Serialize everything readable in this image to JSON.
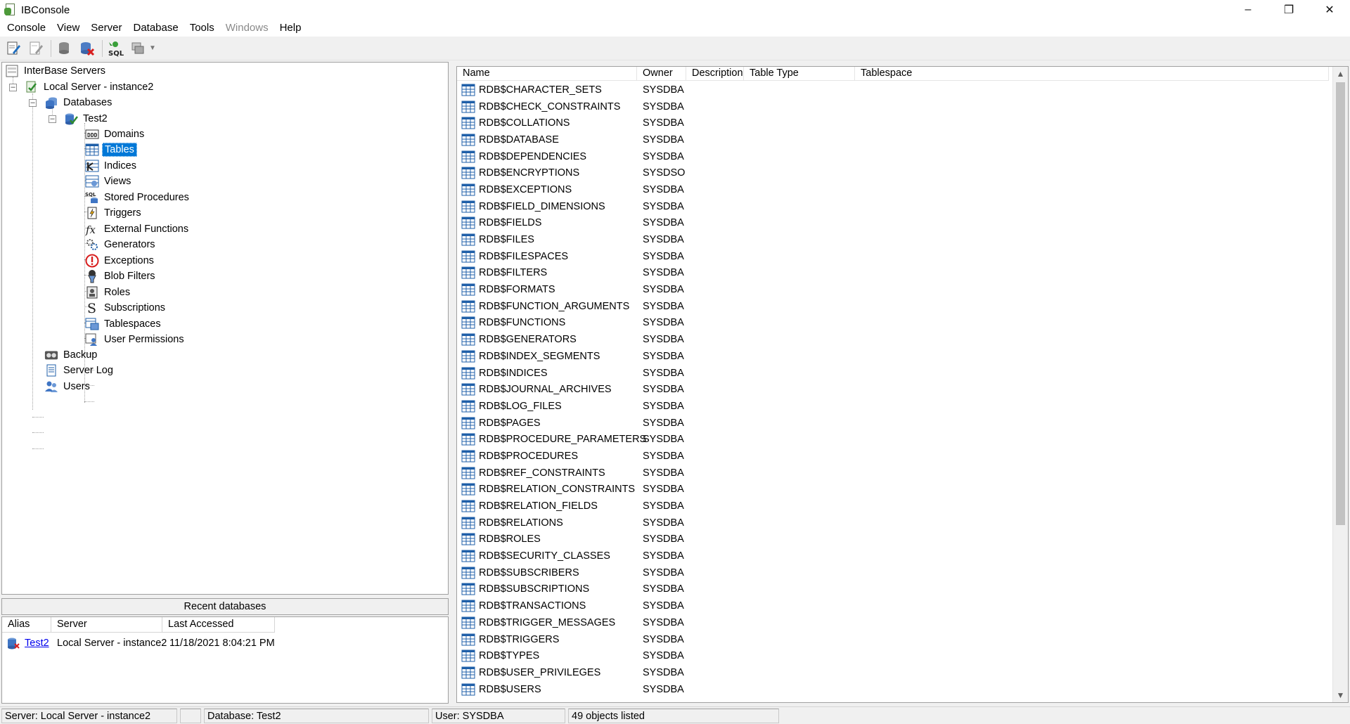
{
  "window": {
    "title": "IBConsole",
    "controls": [
      "–",
      "❐",
      "✕"
    ]
  },
  "menu": [
    {
      "label": "Console",
      "enabled": true
    },
    {
      "label": "View",
      "enabled": true
    },
    {
      "label": "Server",
      "enabled": true
    },
    {
      "label": "Database",
      "enabled": true
    },
    {
      "label": "Tools",
      "enabled": true
    },
    {
      "label": "Windows",
      "enabled": false
    },
    {
      "label": "Help",
      "enabled": true
    }
  ],
  "toolbar": {
    "buttons": [
      "register-server-icon",
      "unregister-server-icon",
      "connect-database-icon",
      "disconnect-database-icon",
      "interactive-sql-icon",
      "window-list-icon"
    ]
  },
  "tree": {
    "root": "InterBase Servers",
    "server": "Local Server - instance2",
    "databases": "Databases",
    "database": "Test2",
    "children": [
      "Domains",
      "Tables",
      "Indices",
      "Views",
      "Stored Procedures",
      "Triggers",
      "External Functions",
      "Generators",
      "Exceptions",
      "Blob Filters",
      "Roles",
      "Subscriptions",
      "Tablespaces",
      "User Permissions"
    ],
    "server_children": [
      "Backup",
      "Server Log",
      "Users"
    ],
    "selected": "Tables"
  },
  "recent": {
    "header": "Recent databases",
    "columns": [
      "Alias",
      "Server",
      "Last Accessed"
    ],
    "rows": [
      {
        "alias": "Test2",
        "server": "Local Server - instance2",
        "last_accessed": "11/18/2021 8:04:21 PM"
      }
    ]
  },
  "list": {
    "columns": [
      "Name",
      "Owner",
      "Description",
      "Table Type",
      "Tablespace"
    ],
    "rows": [
      {
        "name": "RDB$CHARACTER_SETS",
        "owner": "SYSDBA"
      },
      {
        "name": "RDB$CHECK_CONSTRAINTS",
        "owner": "SYSDBA"
      },
      {
        "name": "RDB$COLLATIONS",
        "owner": "SYSDBA"
      },
      {
        "name": "RDB$DATABASE",
        "owner": "SYSDBA"
      },
      {
        "name": "RDB$DEPENDENCIES",
        "owner": "SYSDBA"
      },
      {
        "name": "RDB$ENCRYPTIONS",
        "owner": "SYSDSO"
      },
      {
        "name": "RDB$EXCEPTIONS",
        "owner": "SYSDBA"
      },
      {
        "name": "RDB$FIELD_DIMENSIONS",
        "owner": "SYSDBA"
      },
      {
        "name": "RDB$FIELDS",
        "owner": "SYSDBA"
      },
      {
        "name": "RDB$FILES",
        "owner": "SYSDBA"
      },
      {
        "name": "RDB$FILESPACES",
        "owner": "SYSDBA"
      },
      {
        "name": "RDB$FILTERS",
        "owner": "SYSDBA"
      },
      {
        "name": "RDB$FORMATS",
        "owner": "SYSDBA"
      },
      {
        "name": "RDB$FUNCTION_ARGUMENTS",
        "owner": "SYSDBA"
      },
      {
        "name": "RDB$FUNCTIONS",
        "owner": "SYSDBA"
      },
      {
        "name": "RDB$GENERATORS",
        "owner": "SYSDBA"
      },
      {
        "name": "RDB$INDEX_SEGMENTS",
        "owner": "SYSDBA"
      },
      {
        "name": "RDB$INDICES",
        "owner": "SYSDBA"
      },
      {
        "name": "RDB$JOURNAL_ARCHIVES",
        "owner": "SYSDBA"
      },
      {
        "name": "RDB$LOG_FILES",
        "owner": "SYSDBA"
      },
      {
        "name": "RDB$PAGES",
        "owner": "SYSDBA"
      },
      {
        "name": "RDB$PROCEDURE_PARAMETERS",
        "owner": "SYSDBA"
      },
      {
        "name": "RDB$PROCEDURES",
        "owner": "SYSDBA"
      },
      {
        "name": "RDB$REF_CONSTRAINTS",
        "owner": "SYSDBA"
      },
      {
        "name": "RDB$RELATION_CONSTRAINTS",
        "owner": "SYSDBA"
      },
      {
        "name": "RDB$RELATION_FIELDS",
        "owner": "SYSDBA"
      },
      {
        "name": "RDB$RELATIONS",
        "owner": "SYSDBA"
      },
      {
        "name": "RDB$ROLES",
        "owner": "SYSDBA"
      },
      {
        "name": "RDB$SECURITY_CLASSES",
        "owner": "SYSDBA"
      },
      {
        "name": "RDB$SUBSCRIBERS",
        "owner": "SYSDBA"
      },
      {
        "name": "RDB$SUBSCRIPTIONS",
        "owner": "SYSDBA"
      },
      {
        "name": "RDB$TRANSACTIONS",
        "owner": "SYSDBA"
      },
      {
        "name": "RDB$TRIGGER_MESSAGES",
        "owner": "SYSDBA"
      },
      {
        "name": "RDB$TRIGGERS",
        "owner": "SYSDBA"
      },
      {
        "name": "RDB$TYPES",
        "owner": "SYSDBA"
      },
      {
        "name": "RDB$USER_PRIVILEGES",
        "owner": "SYSDBA"
      },
      {
        "name": "RDB$USERS",
        "owner": "SYSDBA"
      }
    ]
  },
  "status": {
    "server": "Server: Local Server - instance2",
    "database": "Database: Test2",
    "user": "User: SYSDBA",
    "count": "49 objects listed"
  },
  "colors": {
    "selection": "#0078d7",
    "link": "#0000ee",
    "table_icon": "#1f5fa8"
  }
}
